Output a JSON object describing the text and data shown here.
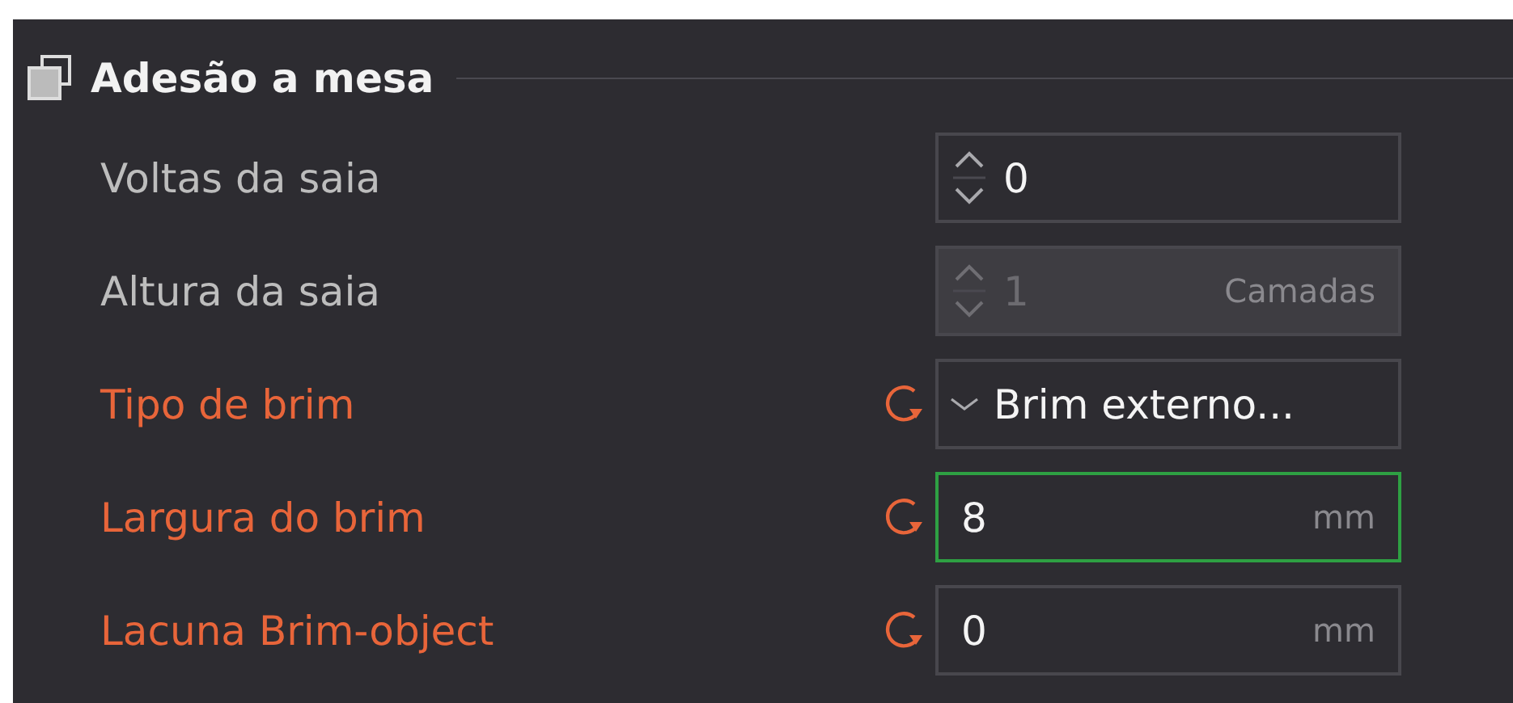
{
  "section": {
    "title": "Adesão a mesa"
  },
  "rows": [
    {
      "label": "Voltas da saia",
      "kind": "spin",
      "value": "0",
      "modified": false,
      "disabled": false,
      "focused": false
    },
    {
      "label": "Altura da saia",
      "kind": "spin",
      "value": "1",
      "unit": "Camadas",
      "modified": false,
      "disabled": true,
      "focused": false
    },
    {
      "label": "Tipo de brim",
      "kind": "combo",
      "value": "Brim externo...",
      "modified": true,
      "disabled": false,
      "focused": false
    },
    {
      "label": "Largura do brim",
      "kind": "number",
      "value": "8",
      "unit": "mm",
      "modified": true,
      "disabled": false,
      "focused": true
    },
    {
      "label": "Lacuna Brim-object",
      "kind": "number",
      "value": "0",
      "unit": "mm",
      "modified": true,
      "disabled": false,
      "focused": false
    }
  ]
}
